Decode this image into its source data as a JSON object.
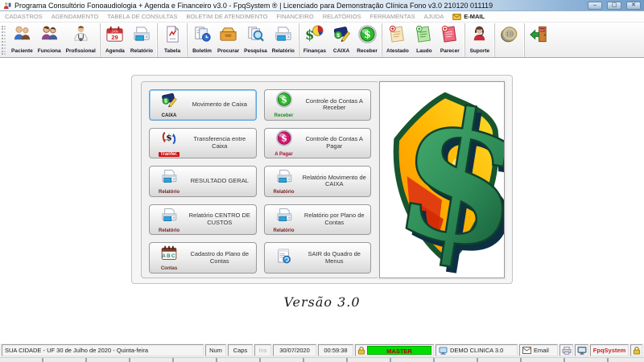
{
  "window": {
    "title": "Programa Consultório Fonoaudiologia + Agenda e Financeiro v3.0 - FpqSystem ® | Licenciado para Demonstração Clínica Fono v3.0 210120 011119",
    "controls": {
      "minimize": "–",
      "maximize": "▢",
      "close": "✕"
    }
  },
  "menu": {
    "items": [
      "CADASTROS",
      "AGENDAMENTO",
      "TABELA DE CONSULTAS",
      "BOLETIM DE ATENDIMENTO",
      "FINANCEIRO",
      "RELATÓRIOS",
      "FERRAMENTAS",
      "AJUDA"
    ],
    "email_label": "E-MAIL"
  },
  "toolbar": {
    "groups": [
      {
        "items": [
          {
            "label": "Paciente",
            "icon": "patients-icon"
          },
          {
            "label": "Funciona",
            "icon": "staff-icon"
          },
          {
            "label": "Profissional",
            "icon": "professional-icon"
          }
        ]
      },
      {
        "items": [
          {
            "label": "Agenda",
            "icon": "calendar-icon"
          },
          {
            "label": "Relatório",
            "icon": "report-printer-icon"
          }
        ]
      },
      {
        "items": [
          {
            "label": "Tabela",
            "icon": "table-document-icon"
          }
        ]
      },
      {
        "items": [
          {
            "label": "Boletim",
            "icon": "bulletin-icon"
          },
          {
            "label": "Procurar",
            "icon": "drawer-icon"
          },
          {
            "label": "Pesquisa",
            "icon": "search-pages-icon"
          },
          {
            "label": "Relatório",
            "icon": "report-printer-icon"
          }
        ]
      },
      {
        "items": [
          {
            "label": "Finanças",
            "icon": "finance-pie-icon"
          },
          {
            "label": "CAIXA",
            "icon": "cashbook-icon"
          },
          {
            "label": "Receber",
            "icon": "receive-dollar-icon"
          }
        ]
      },
      {
        "items": [
          {
            "label": "Atestado",
            "icon": "certificate-note-icon"
          },
          {
            "label": "Laudo",
            "icon": "report-note-icon"
          },
          {
            "label": "Parecer",
            "icon": "opinion-note-icon"
          }
        ]
      },
      {
        "items": [
          {
            "label": "Suporte",
            "icon": "support-icon"
          }
        ]
      },
      {
        "items": [
          {
            "label": "",
            "icon": "coin-icon"
          }
        ]
      },
      {
        "items": [
          {
            "label": "",
            "icon": "exit-door-icon"
          }
        ]
      }
    ]
  },
  "main_menu": {
    "buttons": [
      {
        "label": "Movimento de Caixa",
        "caption": "CAIXA",
        "icon": "cashbook-icon"
      },
      {
        "label": "Controle do Contas A Receber",
        "caption": "Receber",
        "icon": "receive-dollar-icon"
      },
      {
        "label": "Transferencia entre Caixa",
        "caption": "Tranfer.",
        "icon": "transfer-icon"
      },
      {
        "label": "Controle do Contas A Pagar",
        "caption": "A Pagar",
        "icon": "pay-dollar-icon"
      },
      {
        "label": "RESULTADO GERAL",
        "caption": "Relatório",
        "icon": "report-printer-icon"
      },
      {
        "label": "Relatório Movimento de CAIXA",
        "caption": "Relatório",
        "icon": "report-printer-icon"
      },
      {
        "label": "Relatório CENTRO DE CUSTOS",
        "caption": "Relatório",
        "icon": "report-printer-icon"
      },
      {
        "label": "Relatório por Plano de Contas",
        "caption": "Relatório",
        "icon": "report-printer-icon"
      },
      {
        "label": "Cadastro do Plano de Contas",
        "caption": "Contas",
        "icon": "accounts-calendar-icon"
      },
      {
        "label": "SAIR do Quadro de Menus",
        "caption": "",
        "icon": "exit-menus-icon"
      }
    ]
  },
  "hero": {
    "dollar_glyph": "$"
  },
  "version_text": "Versão 3.0",
  "statusbar": {
    "location": "SUA CIDADE - UF 30 de Julho de 2020 - Quinta-feira",
    "num": "Num",
    "caps": "Caps",
    "ins": "Ins",
    "date": "30/07/2020",
    "time": "00:59:38",
    "user": "MASTER",
    "clinic": "DEMO CLINICA 3.0",
    "email": "Email",
    "brand": "FpqSystem"
  },
  "colors": {
    "master_bg": "#00dd00",
    "master_text": "#b00000",
    "brand_red": "#cc2222",
    "receber_green": "#1d8a1d",
    "apagar_pink": "#d6156e",
    "shield_orange": "#ffb300",
    "dollar_green": "#2e8b57"
  }
}
